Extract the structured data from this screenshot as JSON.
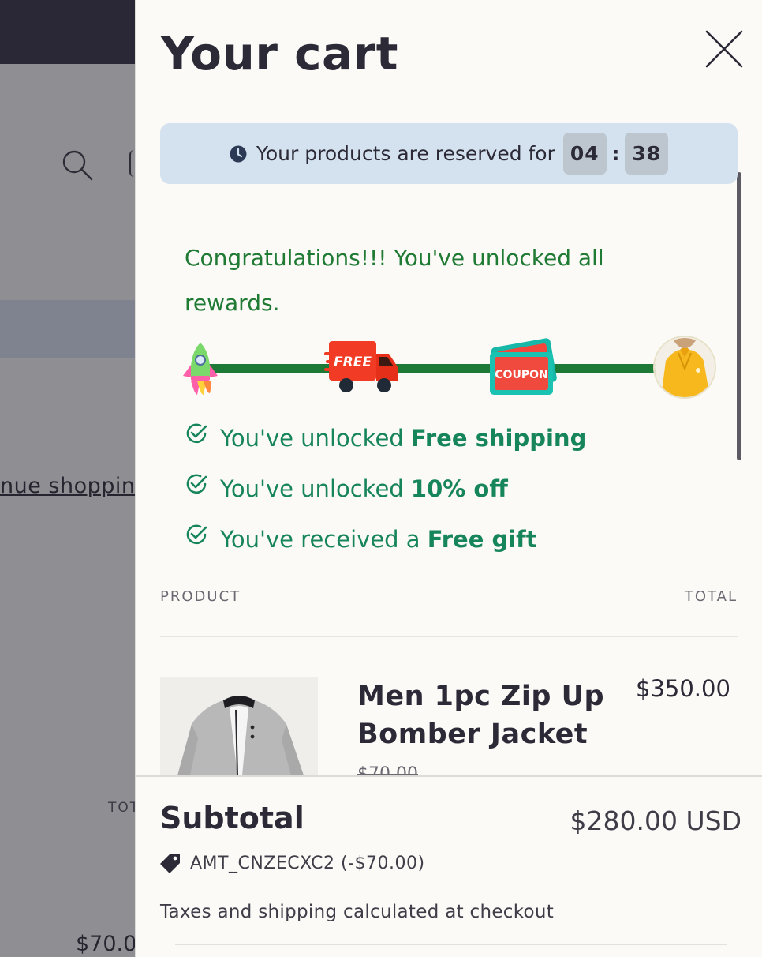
{
  "background": {
    "continue_text": "nue shoppin",
    "total_label": "TOT",
    "price_text": "$70.0"
  },
  "cart": {
    "title": "Your cart",
    "close_icon": "close-icon"
  },
  "timer": {
    "text": "Your products are reserved for",
    "minutes": "04",
    "separator": ":",
    "seconds": "38"
  },
  "rewards": {
    "congrats": "Congratulations!!! You've unlocked all rewards.",
    "milestones": [
      "rocket-icon",
      "free-truck-icon",
      "coupon-icon",
      "gift-product-image"
    ],
    "truck_text": "FREE",
    "coupon_text": "COUPON",
    "items": [
      {
        "prefix": "You've unlocked ",
        "highlight": "Free shipping"
      },
      {
        "prefix": "You've unlocked ",
        "highlight": "10% off"
      },
      {
        "prefix": "You've received a ",
        "highlight": "Free gift"
      }
    ]
  },
  "table": {
    "product_header": "PRODUCT",
    "total_header": "TOTAL"
  },
  "product": {
    "name": "Men 1pc Zip Up Bomber Jacket",
    "price": "$350.00",
    "compare_price": "$70.00"
  },
  "footer": {
    "subtotal_label": "Subtotal",
    "subtotal_value": "$280.00 USD",
    "discount_code": "AMT_CNZECXC2 (-$70.00)",
    "tax_note": "Taxes and shipping calculated at checkout"
  },
  "colors": {
    "drawer_bg": "#fbfaf7",
    "timer_bg": "#d4e2ef",
    "reward_green": "#1f7a34",
    "check_green": "#17855a",
    "text_dark": "#2c2a37"
  }
}
